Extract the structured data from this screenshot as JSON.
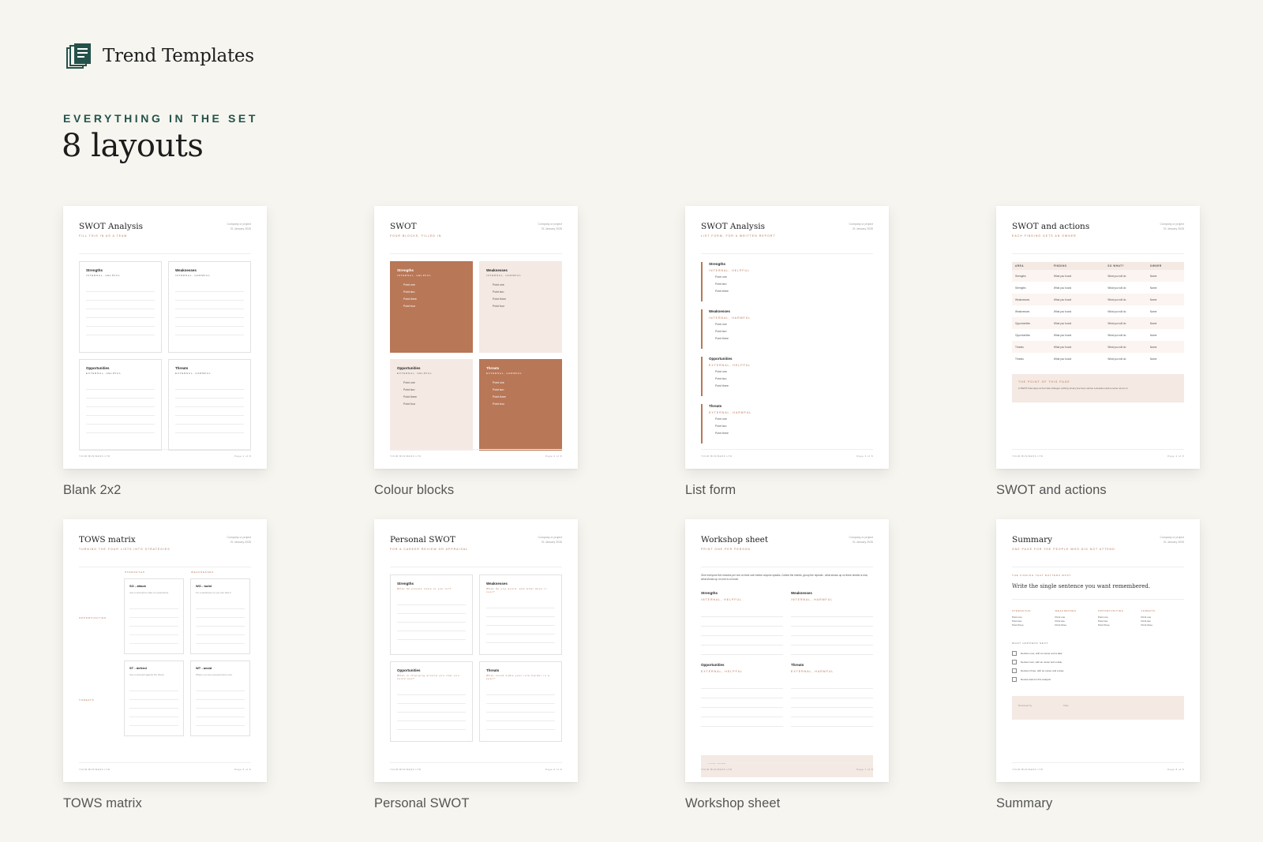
{
  "brand": {
    "name": "Trend Templates",
    "icon": "documents-stack-icon",
    "accent": "#24524a"
  },
  "section": {
    "eyebrow": "EVERYTHING IN THE SET",
    "headline": "8 layouts"
  },
  "common": {
    "meta_company": "Company or project",
    "meta_date": "01 January 2026",
    "footer_left": "YOUR BUSINESS LTD"
  },
  "colors": {
    "terracotta": "#b87757",
    "blush": "#f4e9e3",
    "background": "#f6f5f0"
  },
  "layouts": [
    {
      "label": "Blank 2x2",
      "title": "SWOT Analysis",
      "subtitle": "FILL THIS IN AS A TEAM",
      "page": "Page 1 of 8",
      "quadrants": [
        {
          "name": "Strengths",
          "tag": "INTERNAL, HELPFUL"
        },
        {
          "name": "Weaknesses",
          "tag": "INTERNAL, HARMFUL"
        },
        {
          "name": "Opportunities",
          "tag": "EXTERNAL, HELPFUL"
        },
        {
          "name": "Threats",
          "tag": "EXTERNAL, HARMFUL"
        }
      ]
    },
    {
      "label": "Colour blocks",
      "title": "SWOT",
      "subtitle": "FOUR BLOCKS, FILLED IN",
      "page": "Page 2 of 8",
      "quadrants": [
        {
          "name": "Strengths",
          "tag": "INTERNAL, HELPFUL"
        },
        {
          "name": "Weaknesses",
          "tag": "INTERNAL, HARMFUL"
        },
        {
          "name": "Opportunities",
          "tag": "EXTERNAL, HELPFUL"
        },
        {
          "name": "Threats",
          "tag": "EXTERNAL, HARMFUL"
        }
      ],
      "points": [
        "Point one",
        "Point two",
        "Point three",
        "Point four"
      ]
    },
    {
      "label": "List form",
      "title": "SWOT Analysis",
      "subtitle": "LIST FORM, FOR A WRITTEN REPORT",
      "page": "Page 3 of 8",
      "sections": [
        {
          "name": "Strengths",
          "tag": "INTERNAL, HELPFUL"
        },
        {
          "name": "Weaknesses",
          "tag": "INTERNAL, HARMFUL"
        },
        {
          "name": "Opportunities",
          "tag": "EXTERNAL, HELPFUL"
        },
        {
          "name": "Threats",
          "tag": "EXTERNAL, HARMFUL"
        }
      ],
      "points": [
        "Point one",
        "Point two",
        "Point three"
      ]
    },
    {
      "label": "SWOT and actions",
      "title": "SWOT and actions",
      "subtitle": "EACH FINDING GETS AN OWNER",
      "page": "Page 4 of 8",
      "headers": [
        "AREA",
        "FINDING",
        "SO WHAT?",
        "OWNER"
      ],
      "rows": [
        [
          "Strengths",
          "What you found",
          "What you will do",
          "Name"
        ],
        [
          "Strengths",
          "What you found",
          "What you will do",
          "Name"
        ],
        [
          "Weaknesses",
          "What you found",
          "What you will do",
          "Name"
        ],
        [
          "Weaknesses",
          "What you found",
          "What you will do",
          "Name"
        ],
        [
          "Opportunities",
          "What you found",
          "What you will do",
          "Name"
        ],
        [
          "Opportunities",
          "What you found",
          "What you will do",
          "Name"
        ],
        [
          "Threats",
          "What you found",
          "What you will do",
          "Name"
        ],
        [
          "Threats",
          "What you found",
          "What you will do",
          "Name"
        ]
      ],
      "callout_title": "THE POINT OF THIS PAGE",
      "callout_text": "A SWOT that stops at four lists changes nothing. Every line here carries a decision and a name next to it."
    },
    {
      "label": "TOWS matrix",
      "title": "TOWS matrix",
      "subtitle": "TURNING THE FOUR LISTS INTO STRATEGIES",
      "page": "Page 5 of 8",
      "col_headers": [
        "STRENGTHS",
        "WEAKNESSES"
      ],
      "row_headers": [
        "OPPORTUNITIES",
        "THREATS"
      ],
      "cells": [
        {
          "name": "SO - attack",
          "hint": "Use a strength to take an opportunity"
        },
        {
          "name": "WO - build",
          "hint": "Fix a weakness so you can take it"
        },
        {
          "name": "ST - defend",
          "hint": "Use a strength against the threat"
        },
        {
          "name": "WT - avoid",
          "hint": "Where you are exposed twice over"
        }
      ]
    },
    {
      "label": "Personal SWOT",
      "title": "Personal SWOT",
      "subtitle": "FOR A CAREER REVIEW OR APPRAISAL",
      "page": "Page 6 of 8",
      "quadrants": [
        {
          "name": "Strengths",
          "hint": "What do people come to you for?"
        },
        {
          "name": "Weaknesses",
          "hint": "What do you avoid, and what does it cost?"
        },
        {
          "name": "Opportunities",
          "hint": "What is changing around you that you could use?"
        },
        {
          "name": "Threats",
          "hint": "What could make your role harder in a year?"
        }
      ]
    },
    {
      "label": "Workshop sheet",
      "title": "Workshop sheet",
      "subtitle": "PRINT ONE PER PERSON",
      "page": "Page 7 of 8",
      "intro": "Give everyone five minutes per box on their own before anyone speaks. Collect the sheets, group the repeats - what shows up on three sheets is real, what shows up on one is a hunch.",
      "quadrants": [
        {
          "name": "Strengths",
          "tag": "INTERNAL, HELPFUL"
        },
        {
          "name": "Weaknesses",
          "tag": "INTERNAL, HARMFUL"
        },
        {
          "name": "Opportunities",
          "tag": "EXTERNAL, HELPFUL"
        },
        {
          "name": "Threats",
          "tag": "EXTERNAL, HARMFUL"
        }
      ],
      "name_label": "YOUR NAME"
    },
    {
      "label": "Summary",
      "title": "Summary",
      "subtitle": "ONE PAGE FOR THE PEOPLE WHO DID NOT ATTEND",
      "page": "Page 8 of 8",
      "finding_tag": "THE FINDING THAT MATTERS MOST",
      "finding": "Write the single sentence you want remembered.",
      "columns": [
        "STRENGTHS",
        "WEAKNESSES",
        "OPPORTUNITIES",
        "THREATS"
      ],
      "points": [
        "Point one",
        "Point two",
        "Point three"
      ],
      "next_tag": "WHAT HAPPENS NEXT",
      "checks": [
        "Decision one, with an owner and a date",
        "Decision two, with an owner and a date",
        "Decision three, with an owner and a date",
        "Review date for this analysis"
      ],
      "sign_reviewed": "Reviewed by",
      "sign_date": "Date"
    }
  ]
}
